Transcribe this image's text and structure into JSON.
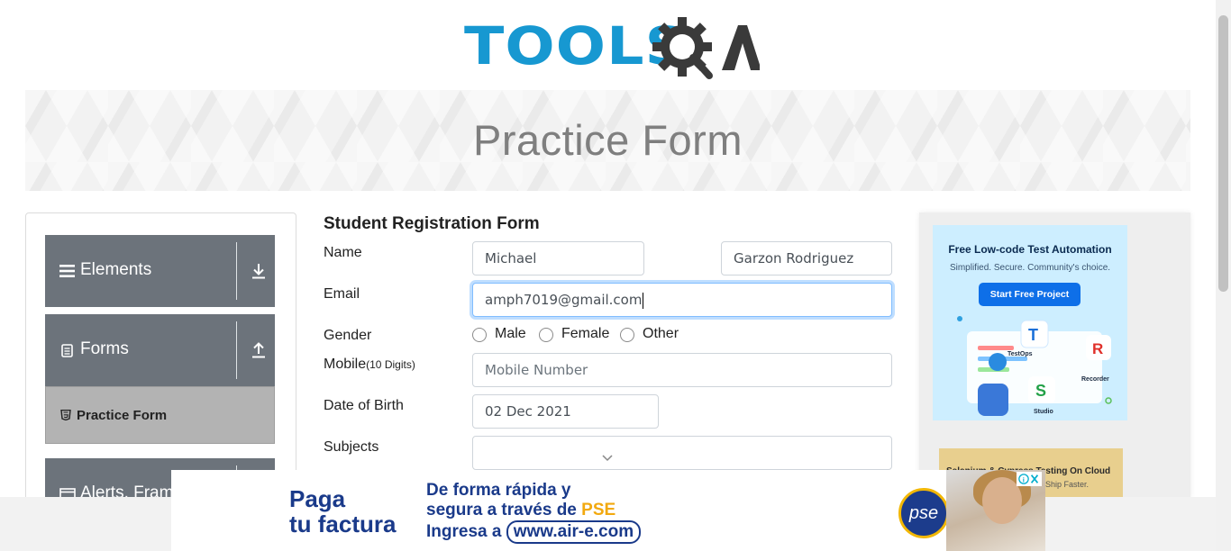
{
  "header": {
    "logo_text": "TOOLS",
    "logo_qa": "QA"
  },
  "banner": {
    "title": "Practice Form"
  },
  "sidebar": {
    "groups": [
      {
        "label": "Elements",
        "icon": "hamburger-icon",
        "arrow": "download-arrow-icon"
      },
      {
        "label": "Forms",
        "icon": "document-icon",
        "arrow": "upload-arrow-icon"
      },
      {
        "label": "Alerts, Frame & Windows",
        "icon": "window-icon"
      }
    ],
    "active_item": {
      "label": "Practice Form",
      "icon": "html5-icon"
    }
  },
  "form": {
    "title": "Student Registration Form",
    "name_label": "Name",
    "first_name_value": "Michael",
    "last_name_value": "Garzon Rodriguez",
    "email_label": "Email",
    "email_value": "amph7019@gmail.com",
    "gender_label": "Gender",
    "gender_options": [
      "Male",
      "Female",
      "Other"
    ],
    "mobile_label": "Mobile",
    "mobile_hint": "(10 Digits)",
    "mobile_placeholder": "Mobile Number",
    "dob_label": "Date of Birth",
    "dob_value": "02 Dec 2021",
    "subjects_label": "Subjects"
  },
  "right_ad": {
    "title": "Free Low-code Test Automation",
    "subtitle": "Simplified. Secure. Community's choice.",
    "button": "Start Free Project",
    "labels": [
      "TestOps",
      "Recorder",
      "Studio"
    ],
    "second_title": "Selenium & Cypress Testing On Cloud",
    "second_subtitle": "Ship Faster."
  },
  "bottom_ad": {
    "line1": "Paga",
    "line2": "tu factura",
    "mid1": "De forma rápida y",
    "mid2a": "segura a través de ",
    "mid2b": "PSE",
    "mid3a": "Ingresa a ",
    "mid3url": "www.air-e.com",
    "logo": "pse"
  },
  "colors": {
    "accent": "#1798d1",
    "sidebar_group": "#6c737b",
    "sidebar_active": "#b3b3b3",
    "focus": "#80bdff"
  }
}
